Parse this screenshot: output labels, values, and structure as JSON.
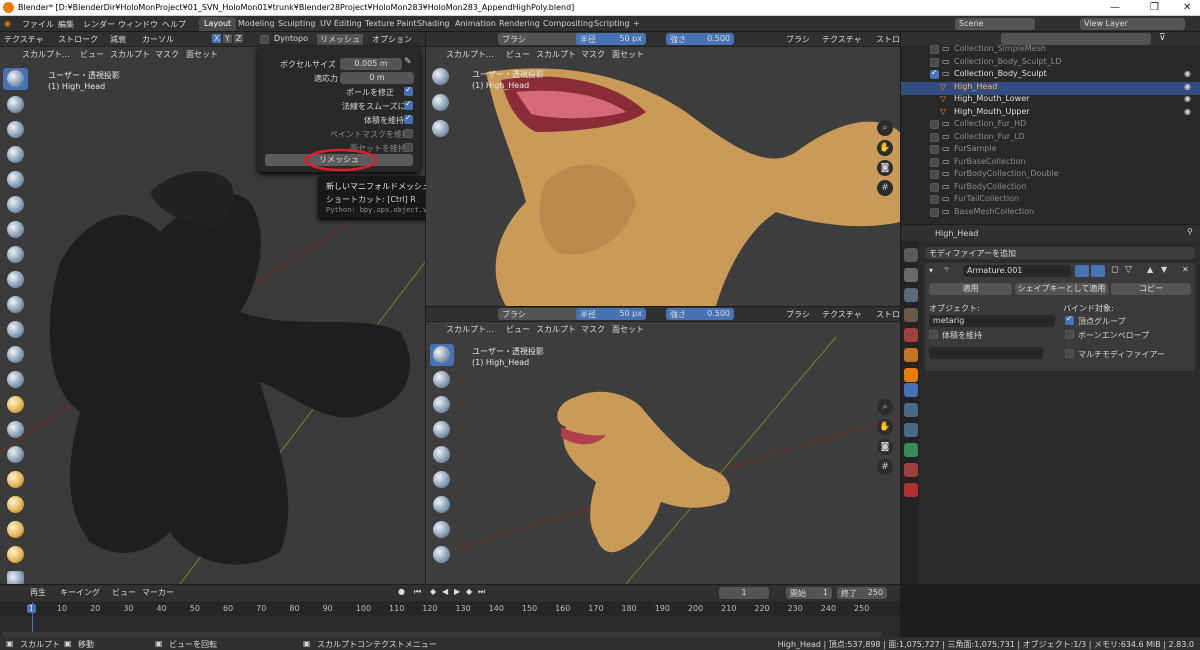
{
  "titlebar": {
    "title": "Blender* [D:¥BlenderDir¥HoloMonProject¥01_SVN_HoloMon01¥trunk¥Blender28Project¥HoloMon283¥HoloMon283_AppendHighPoly.blend]",
    "minimize": "—",
    "maximize": "❐",
    "close": "✕"
  },
  "menu": {
    "items": [
      "ファイル",
      "編集",
      "レンダー",
      "ウィンドウ",
      "ヘルプ"
    ]
  },
  "workspaces": [
    "Layout",
    "Modeling",
    "Sculpting",
    "UV Editing",
    "Texture Paint",
    "Shading",
    "Animation",
    "Rendering",
    "Compositing",
    "Scripting"
  ],
  "workspace_add": "+",
  "scene": {
    "label": "Scene",
    "viewlayer": "View Layer"
  },
  "left_header": {
    "items": [
      "テクスチャ",
      "ストローク",
      "減衰",
      "カーソル"
    ],
    "axes": [
      "X",
      "Y",
      "Z"
    ],
    "dyntopo": "Dyntopo",
    "remesh": "リメッシュ",
    "options": "オプション"
  },
  "left_header2": {
    "items": [
      "スカルプト...",
      "ビュー",
      "スカルプト",
      "マスク",
      "面セット"
    ]
  },
  "remesh_panel": {
    "voxel_label": "ボクセルサイズ",
    "voxel_value": "0.005 m",
    "adaptivity_label": "適応力",
    "adaptivity_value": "0 m",
    "fix_poles": "ポールを修正",
    "smooth_normals": "法線をスムーズに",
    "preserve_volume": "体積を維持",
    "paint_mask": "ペイントマスクを維持",
    "face_sets": "面セットを維持",
    "button": "リメッシュ"
  },
  "tooltip": {
    "desc": "新しいマニフォルドメッシュを、現在のメッシュのボリュームを元に計算します。データレイヤーはすべて失われます。",
    "shortcut": "ショートカット: [Ctrl] R",
    "python": "Python: bpy.ops.object.voxel_remesh()"
  },
  "viewport_left": {
    "view": "ユーザー・透視投影",
    "object": "(1) High_Head"
  },
  "viewport_tr": {
    "view": "ユーザー・透視投影",
    "object": "(1) High_Head"
  },
  "viewport_br": {
    "view": "ユーザー・透視投影",
    "object": "(1) High_Head"
  },
  "brush_header": {
    "brush": "ブラシ",
    "radius_label": "半径",
    "radius_value": "50 px",
    "strength_label": "強さ",
    "strength_value": "0.500",
    "texture": "テクスチャ",
    "stroke": "ストロ"
  },
  "vp_header": {
    "items": [
      "スカルプト...",
      "ビュー",
      "スカルプト",
      "マスク",
      "面セット"
    ]
  },
  "outliner": {
    "search": "",
    "items": [
      {
        "name": "Collection_SimpleMesh",
        "dim": true
      },
      {
        "name": "Collection_Body_Sculpt_LD",
        "dim": true
      },
      {
        "name": "Collection_Body_Sculpt",
        "dim": false
      },
      {
        "name": "High_Head",
        "dim": false,
        "selected": true
      },
      {
        "name": "High_Mouth_Lower",
        "dim": false
      },
      {
        "name": "High_Mouth_Upper",
        "dim": false
      },
      {
        "name": "Collection_Fur_HD",
        "dim": true
      },
      {
        "name": "Collection_Fur_LD",
        "dim": true
      },
      {
        "name": "FurSample",
        "dim": true
      },
      {
        "name": "FurBaseCollection",
        "dim": true
      },
      {
        "name": "FurBodyCollection_Double",
        "dim": true
      },
      {
        "name": "FurBodyCollection",
        "dim": true
      },
      {
        "name": "FurTailCollection",
        "dim": true
      },
      {
        "name": "BaseMeshCollection",
        "dim": true
      }
    ]
  },
  "properties": {
    "object": "High_Head",
    "add_modifier": "モディファイアーを追加",
    "modifier_name": "Armature.001",
    "apply": "適用",
    "apply_shape": "シェイプキーとして適用",
    "copy": "コピー",
    "object_label": "オブジェクト:",
    "object_value": "metarig",
    "bind_label": "バインド対象:",
    "vertex_groups": "頂点グループ",
    "bone_envelopes": "ボーンエンベロープ",
    "preserve_volume": "体積を維持",
    "multi_modifier": "マルチモディファイアー"
  },
  "timeline": {
    "items": [
      "再生",
      "キーイング",
      "ビュー",
      "マーカー"
    ],
    "frame": "1",
    "start_label": "開始",
    "start": "1",
    "end_label": "終了",
    "end": "250",
    "ticks": [
      "1",
      "10",
      "20",
      "30",
      "40",
      "50",
      "60",
      "70",
      "80",
      "90",
      "100",
      "110",
      "120",
      "130",
      "140",
      "150",
      "160",
      "170",
      "180",
      "190",
      "200",
      "210",
      "220",
      "230",
      "240",
      "250"
    ]
  },
  "statusbar": {
    "left": [
      "スカルプト",
      "移動",
      "ビューを回転",
      "スカルプトコンテクストメニュー"
    ],
    "right": "High_Head | 頂点:537,898 | 面:1,075,727 | 三角面:1,075,731 | オブジェクト:1/3 | メモリ:634.6 MiB | 2.83.0"
  },
  "colors": {
    "accent": "#4772b3",
    "highlight_circle": "#e0202c",
    "model": "#c99a58",
    "dark_model": "#1e1e1e"
  }
}
